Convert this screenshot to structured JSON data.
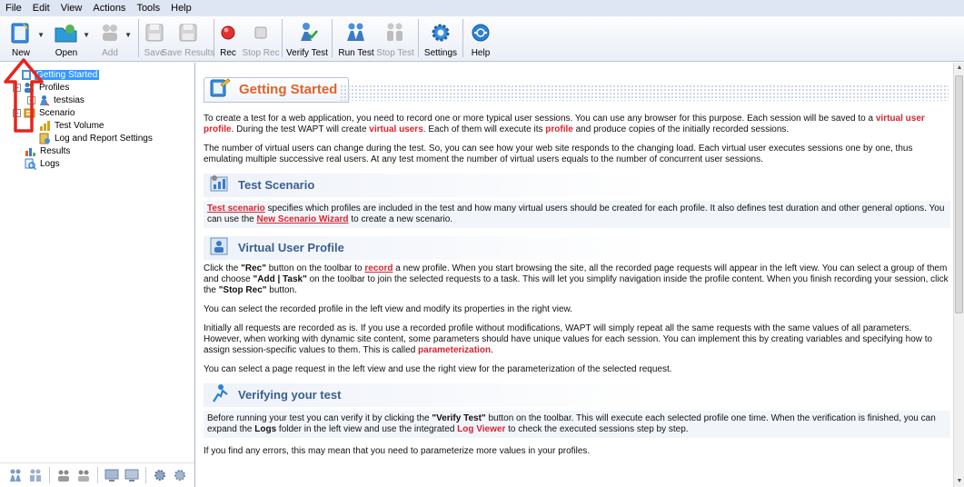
{
  "menu": [
    "File",
    "Edit",
    "View",
    "Actions",
    "Tools",
    "Help"
  ],
  "toolbar": {
    "new": "New",
    "open": "Open",
    "add": "Add",
    "save": "Save",
    "save_results": "Save Results",
    "rec": "Rec",
    "stop_rec": "Stop Rec",
    "verify_test": "Verify Test",
    "run_test": "Run Test",
    "stop_test": "Stop Test",
    "settings": "Settings",
    "help": "Help"
  },
  "tree": {
    "getting_started": "Getting Started",
    "profiles": "Profiles",
    "testsias": "testsias",
    "scenario": "Scenario",
    "test_volume": "Test Volume",
    "log_report": "Log and Report Settings",
    "results": "Results",
    "logs": "Logs"
  },
  "content": {
    "title": "Getting Started",
    "intro1_a": "To create a test for a web application, you need to record one or more typical user sessions. You can use any browser for this purpose. Each session will be saved to a ",
    "intro1_b": "virtual user profile",
    "intro1_c": ". During the test WAPT will create ",
    "intro1_d": "virtual users",
    "intro1_e": ". Each of them will execute its ",
    "intro1_f": "profile",
    "intro1_g": " and produce copies of the initially recorded sessions.",
    "intro2": "The number of virtual users can change during the test. So, you can see how your web site responds to the changing load. Each virtual user executes sessions one by one, thus emulating multiple successive real users. At any test moment the number of virtual users equals to the number of concurrent user sessions.",
    "scenario_title": "Test Scenario",
    "scenario_a": "Test scenario",
    "scenario_b": " specifies which profiles are included in the test and how many virtual users should be created for each profile. It also defines test duration and other general options. You can use the ",
    "scenario_c": "New Scenario Wizard",
    "scenario_d": " to create a new scenario.",
    "vup_title": "Virtual User Profile",
    "vup1_a": "Click the ",
    "vup1_b": "\"Rec\"",
    "vup1_c": " button on the toolbar to ",
    "vup1_d": "record",
    "vup1_e": " a new profile. When you start browsing the site, all the recorded page requests will appear in the left view. You can select a group of them and choose ",
    "vup1_f": "\"Add | Task\"",
    "vup1_g": " on the toolbar to join the selected requests to a task. This will let you simplify navigation inside the profile content. When you finish recording your session, click the ",
    "vup1_h": "\"Stop Rec\"",
    "vup1_i": " button.",
    "vup2": "You can select the recorded profile in the left view and modify its properties in the right view.",
    "vup3_a": "Initially all requests are recorded as is. If you use a recorded profile without modifications, WAPT will simply repeat all the same requests with the same values of all parameters. However, when working with dynamic site content, some parameters should have unique values for each session. You can implement this by creating variables and specifying how to assign session-specific values to them. This is called ",
    "vup3_b": "parameterization",
    "vup3_c": ".",
    "vup4": "You can select a page request in the left view and use the right view for the parameterization of the selected request.",
    "verify_title": "Verifying your test",
    "verify1_a": "Before running your test you can verify it by clicking the ",
    "verify1_b": "\"Verify Test\"",
    "verify1_c": " button on the toolbar. This will execute each selected profile one time. When the verification is finished, you can expand the ",
    "verify1_d": "Logs",
    "verify1_e": " folder in the left view and use the integrated ",
    "verify1_f": "Log Viewer",
    "verify1_g": " to check the executed sessions step by step.",
    "verify2": "If you find any errors, this may mean that you need to parameterize more values in your profiles."
  },
  "colors": {
    "accent_orange": "#e0622a",
    "highlight_red": "#d9232e",
    "section_blue": "#3a5f8f",
    "selection": "#3399ff"
  }
}
